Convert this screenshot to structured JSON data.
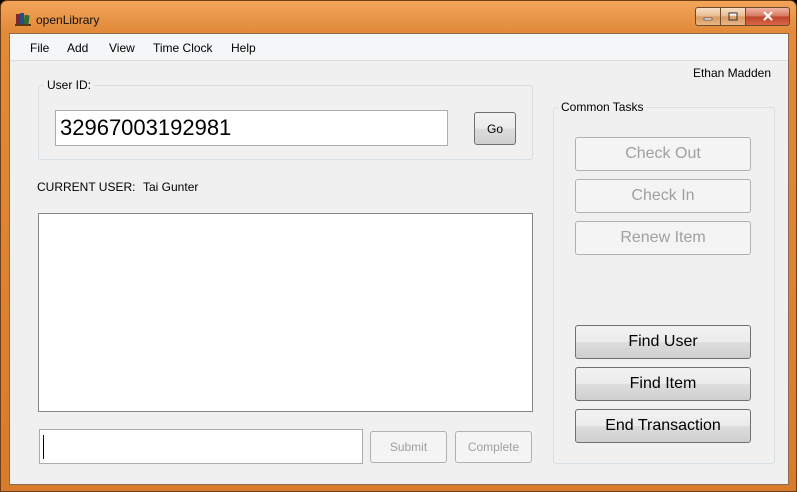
{
  "window": {
    "title": "openLibrary"
  },
  "menu": [
    {
      "label": "File"
    },
    {
      "label": "Add"
    },
    {
      "label": "View"
    },
    {
      "label": "Time Clock"
    },
    {
      "label": "Help"
    }
  ],
  "logged_in_user": "Ethan Madden",
  "user_id_group": {
    "label": "User ID:",
    "value": "32967003192981",
    "go_label": "Go"
  },
  "current_user": {
    "label": "CURRENT USER:",
    "value": "Tai Gunter"
  },
  "entry": {
    "value": "",
    "submit_label": "Submit",
    "complete_label": "Complete"
  },
  "common_tasks": {
    "label": "Common Tasks",
    "check_out": "Check Out",
    "check_in": "Check In",
    "renew_item": "Renew Item",
    "find_user": "Find User",
    "find_item": "Find Item",
    "end_transaction": "End Transaction"
  },
  "icons": {
    "app": "book-stack-icon",
    "minimize": "minimize-icon",
    "maximize": "maximize-icon",
    "close": "close-icon"
  }
}
